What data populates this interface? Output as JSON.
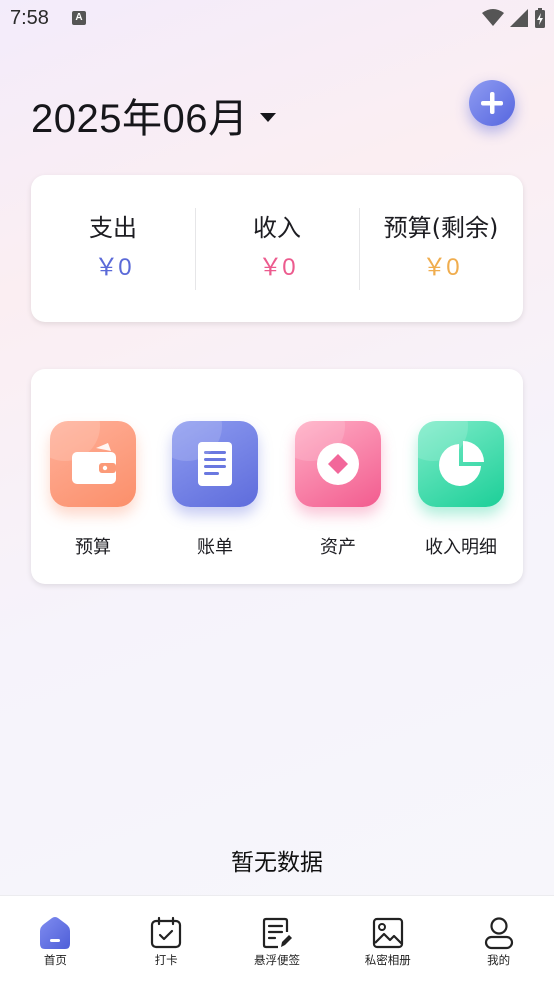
{
  "status_bar": {
    "time": "7:58",
    "notification_badge": "A"
  },
  "header": {
    "month": "2025年06月"
  },
  "summary": [
    {
      "label": "支出",
      "value": "￥0",
      "color": "#5b6ad8"
    },
    {
      "label": "收入",
      "value": "￥0",
      "color": "#ec5b8e"
    },
    {
      "label": "预算(剩余)",
      "value": "￥0",
      "color": "#f0ad4e"
    }
  ],
  "actions": [
    {
      "label": "预算",
      "icon": "wallet-icon"
    },
    {
      "label": "账单",
      "icon": "document-icon"
    },
    {
      "label": "资产",
      "icon": "diamond-icon"
    },
    {
      "label": "收入明细",
      "icon": "pie-chart-icon"
    }
  ],
  "empty_state": "暂无数据",
  "bottom_nav": [
    {
      "label": "首页",
      "icon": "home-icon",
      "active": true
    },
    {
      "label": "打卡",
      "icon": "calendar-check-icon"
    },
    {
      "label": "悬浮便签",
      "icon": "note-edit-icon"
    },
    {
      "label": "私密相册",
      "icon": "image-icon"
    },
    {
      "label": "我的",
      "icon": "person-icon"
    }
  ]
}
